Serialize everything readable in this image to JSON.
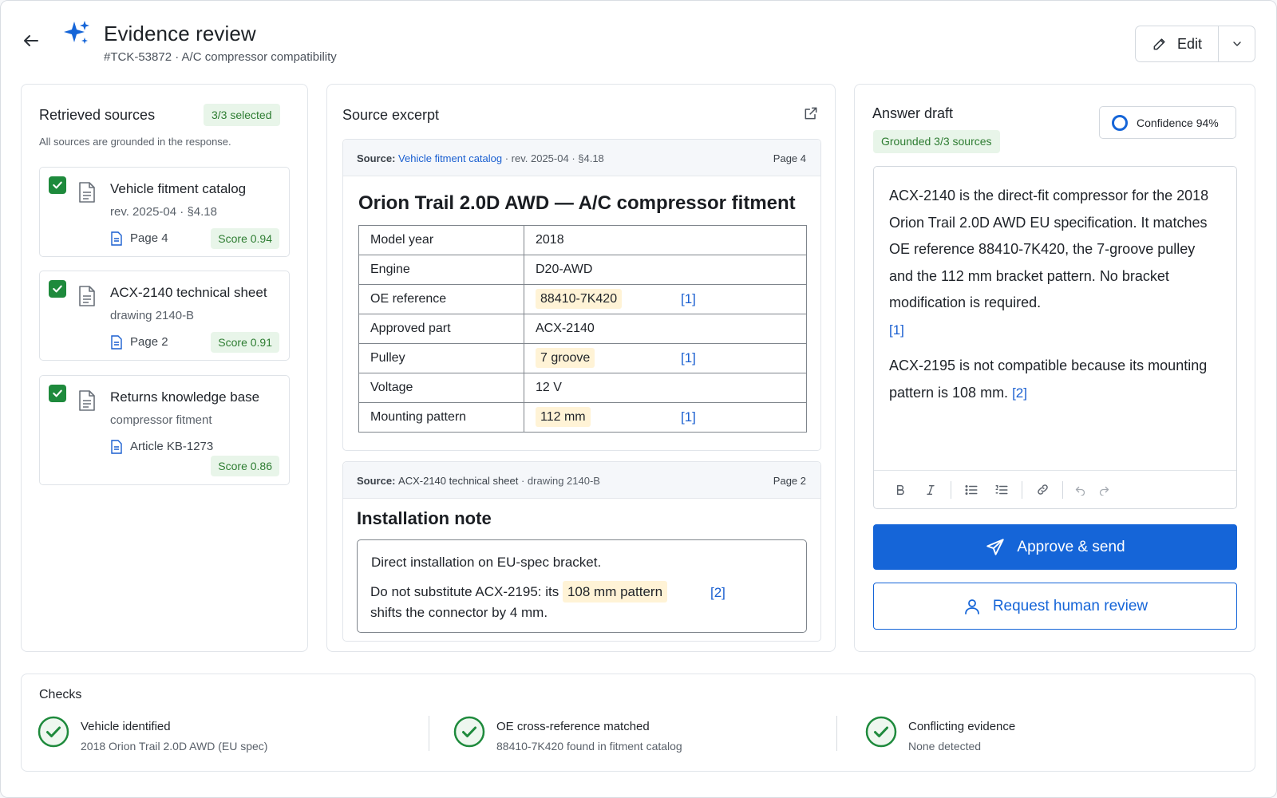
{
  "header": {
    "title": "Evidence review",
    "subtitle": "#TCK-53872 · A/C compressor compatibility",
    "edit_label": "Edit"
  },
  "sources": {
    "title": "Retrieved sources",
    "selected_badge": "3/3 selected",
    "note": "All sources are grounded in the response.",
    "items": [
      {
        "name": "Vehicle fitment catalog",
        "meta": "rev. 2025-04 · §4.18",
        "page": "Page 4",
        "score": "Score 0.94",
        "checked": true
      },
      {
        "name": "ACX-2140 technical sheet",
        "meta": "drawing 2140-B",
        "page": "Page 2",
        "score": "Score 0.91",
        "checked": true
      },
      {
        "name": "Returns knowledge base",
        "meta": "compressor fitment",
        "page": "Article KB-1273",
        "score": "Score 0.86",
        "checked": true
      }
    ]
  },
  "excerpt": {
    "title": "Source excerpt",
    "card1": {
      "source_label": "Source:",
      "source_name": "Vehicle fitment catalog",
      "source_meta": "· rev. 2025-04 · §4.18",
      "page": "Page 4",
      "heading": "Orion Trail 2.0D AWD — A/C compressor fitment",
      "rows": [
        {
          "key": "Model year",
          "value": "2018",
          "highlight": false,
          "cite": ""
        },
        {
          "key": "Engine",
          "value": "D20-AWD",
          "highlight": false,
          "cite": ""
        },
        {
          "key": "OE reference",
          "value": "88410-7K420",
          "highlight": true,
          "cite": "[1]"
        },
        {
          "key": "Approved part",
          "value": "ACX-2140",
          "highlight": false,
          "cite": ""
        },
        {
          "key": "Pulley",
          "value": "7 groove",
          "highlight": true,
          "cite": "[1]"
        },
        {
          "key": "Voltage",
          "value": "12 V",
          "highlight": false,
          "cite": ""
        },
        {
          "key": "Mounting pattern",
          "value": "112 mm",
          "highlight": true,
          "cite": "[1]"
        }
      ]
    },
    "card2": {
      "source_label": "Source:",
      "source_name": "ACX-2140 technical sheet",
      "source_meta": "· drawing 2140-B",
      "page": "Page 2",
      "heading": "Installation note",
      "line1": "Direct installation on EU-spec bracket.",
      "line2_pre": "Do not substitute ACX-2195: its ",
      "line2_hl": "108 mm pattern",
      "line2_post": "shifts the connector by 4 mm.",
      "cite": "[2]"
    }
  },
  "answer": {
    "title": "Answer draft",
    "grounded_badge": "Grounded 3/3 sources",
    "confidence": "Confidence 94%",
    "para1": "ACX-2140 is the direct-fit compressor for the 2018 Orion Trail 2.0D AWD EU specification. It matches OE reference 88410-7K420, the 7-groove pulley and the 112 mm bracket pattern. No bracket modification is required.",
    "para1_cite": "[1]",
    "para2": "ACX-2195 is not compatible because its mounting pattern is 108 mm.",
    "para2_cite": "[2]",
    "approve_label": "Approve & send",
    "review_label": "Request human review"
  },
  "checks": {
    "title": "Checks",
    "items": [
      {
        "label": "Vehicle identified",
        "sub": "2018 Orion Trail 2.0D AWD (EU spec)"
      },
      {
        "label": "OE cross-reference matched",
        "sub": "88410-7K420 found in fitment catalog"
      },
      {
        "label": "Conflicting evidence",
        "sub": "None detected"
      }
    ]
  },
  "colors": {
    "primary": "#1565d8",
    "success": "#1e8a3c",
    "badge_bg": "#e8f5e9",
    "highlight": "#fff3d6"
  }
}
